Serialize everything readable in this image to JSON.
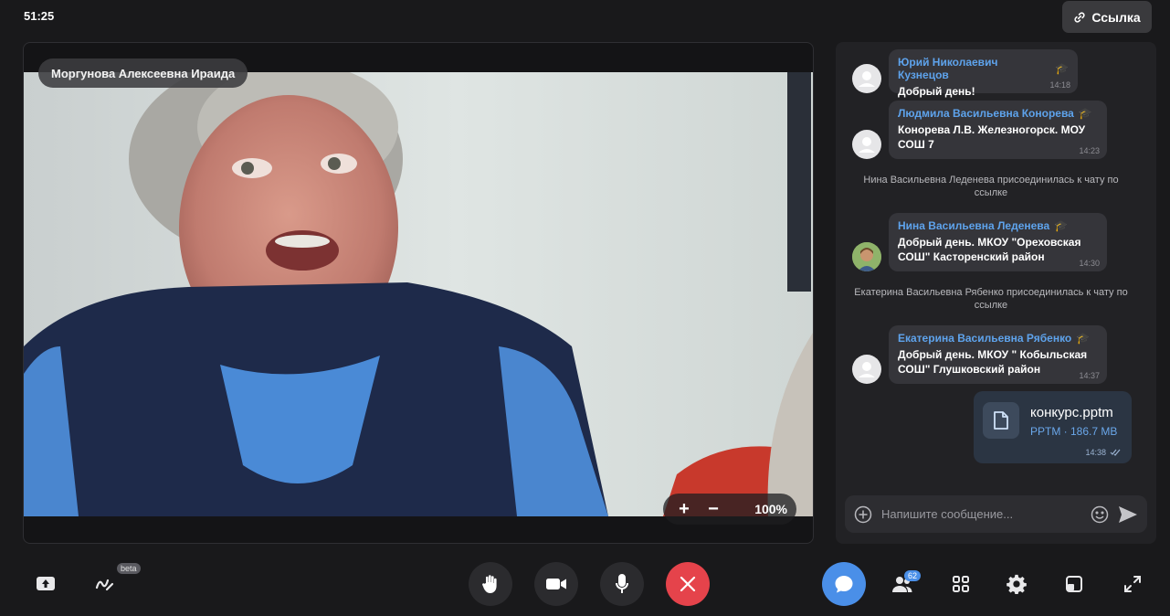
{
  "timer": "51:25",
  "link_button": {
    "label": "Ссылка"
  },
  "video": {
    "participant_name": "Моргунова Алексеевна Ираида",
    "zoom": {
      "plus": "+",
      "minus": "−",
      "level": "100%"
    }
  },
  "chat": {
    "messages": [
      {
        "author": "Юрий Николаевич Кузнецов",
        "text": "Добрый день!",
        "time": "14:18"
      },
      {
        "author": "Людмила Васильевна Конорева",
        "text": "Конорева Л.В. Железногорск. МОУ СОШ 7",
        "time": "14:23"
      },
      {
        "author": "Нина Васильевна Леденева",
        "text": "Добрый день. МКОУ \"Ореховская СОШ\" Касторенский район",
        "time": "14:30"
      },
      {
        "author": "Екатерина Васильевна Рябенко",
        "text": "Добрый день. МКОУ \" Кобыльская СОШ\" Глушковский район",
        "time": "14:37"
      }
    ],
    "system": [
      "Нина Васильевна Леденева присоединилась к чату по ссылке",
      "Екатерина Васильевна Рябенко присоединилась к чату по ссылке"
    ],
    "file": {
      "name": "конкурс.pptm",
      "meta": "PPTM · 186.7 MB",
      "time": "14:38"
    },
    "input_placeholder": "Напишите сообщение..."
  },
  "toolbar": {
    "beta_label": "beta",
    "participants_count": "62"
  },
  "colors": {
    "accent_blue": "#4a8fe8",
    "end_call_red": "#e5434b",
    "author_blue": "#5ea3ec"
  }
}
